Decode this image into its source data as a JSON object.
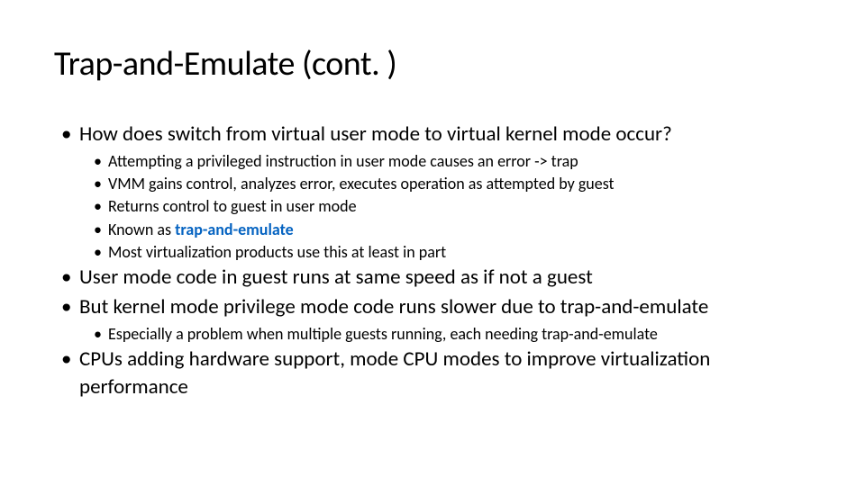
{
  "title": "Trap-and-Emulate (cont. )",
  "b1": "How does switch from virtual user mode to virtual kernel mode occur?",
  "s1a": "Attempting a privileged instruction in user mode causes an error -> trap",
  "s1b": "VMM gains control, analyzes error, executes operation as attempted by guest",
  "s1c": "Returns control to guest in user mode",
  "s1d_pre": "Known as ",
  "s1d_em": "trap-and-emulate",
  "s1e": "Most virtualization products use this at least in part",
  "b2": "User mode code in guest runs at same speed as if not a guest",
  "b3": "But kernel mode privilege mode code runs slower due to trap-and-emulate",
  "s3a": "Especially a problem when multiple guests running, each needing trap-and-emulate",
  "b4": "CPUs adding hardware support, mode CPU modes to improve virtualization performance"
}
